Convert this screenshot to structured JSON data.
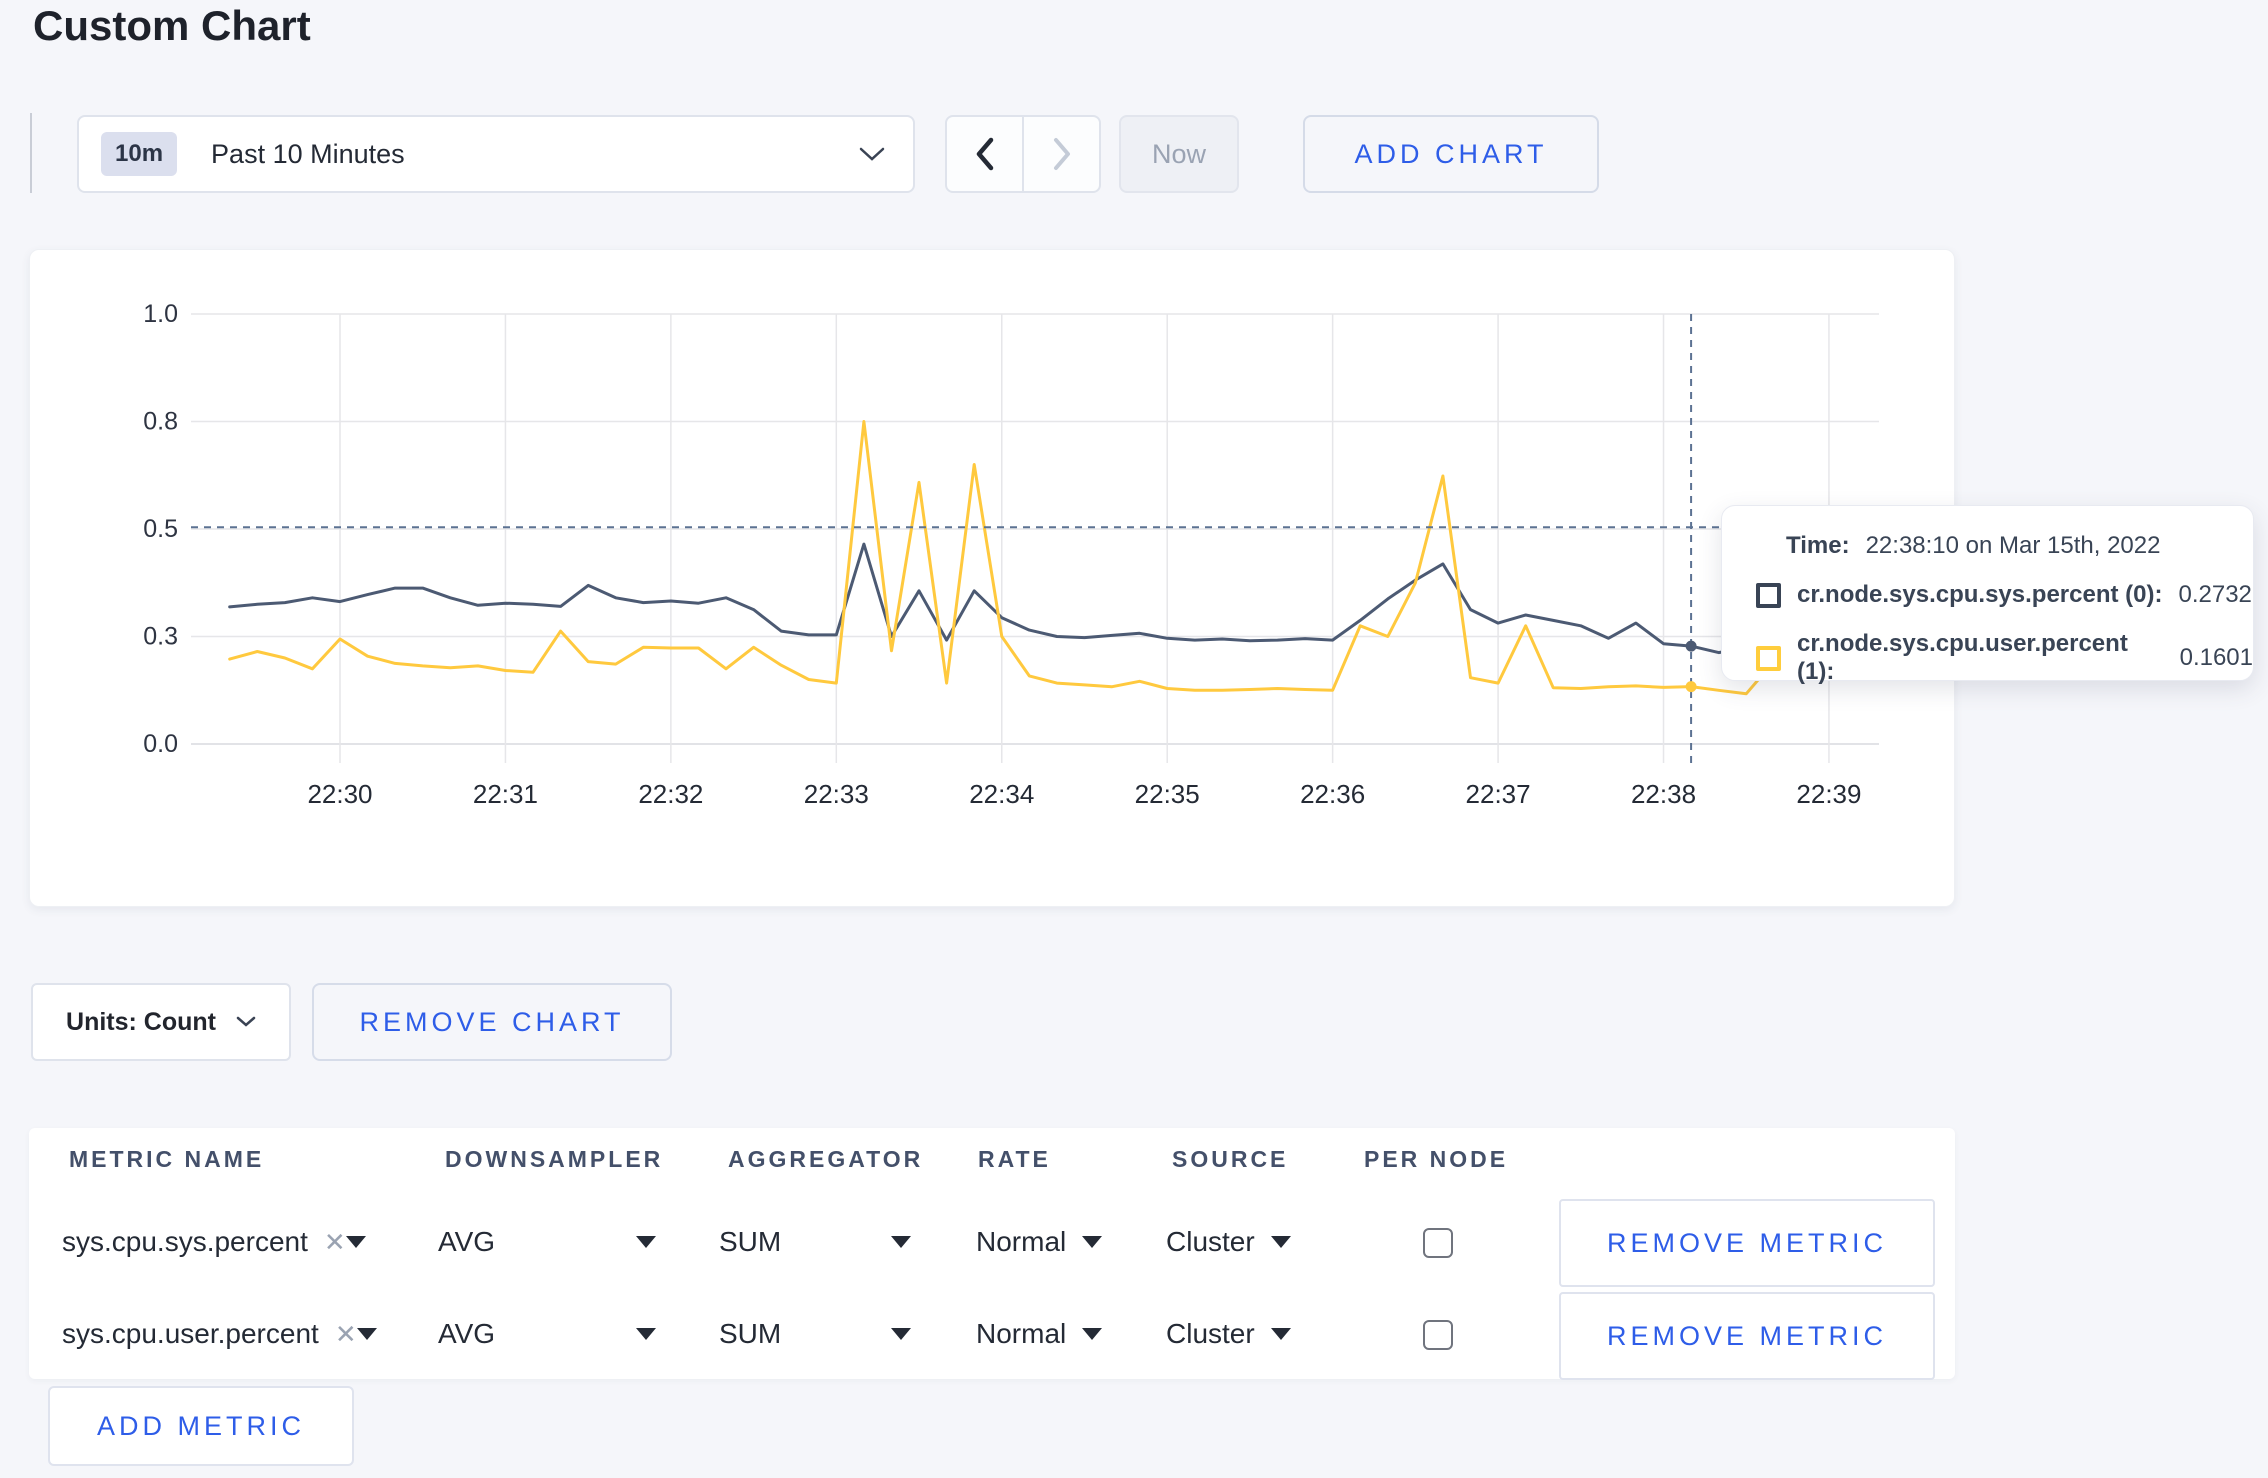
{
  "page": {
    "title": "Custom Chart"
  },
  "toolbar": {
    "time_window_badge": "10m",
    "time_window_label": "Past 10 Minutes",
    "now_label": "Now",
    "add_chart_label": "ADD CHART"
  },
  "chart_data": {
    "type": "line",
    "title": "",
    "x_ticks": [
      "22:30",
      "22:31",
      "22:32",
      "22:33",
      "22:34",
      "22:35",
      "22:36",
      "22:37",
      "22:38",
      "22:39"
    ],
    "y_ticks": {
      "labels": [
        "0.0",
        "0.3",
        "0.5",
        "0.8",
        "1.0"
      ],
      "values": [
        0,
        0.3,
        0.5,
        0.8,
        1.0
      ]
    },
    "ylim": [
      0,
      1
    ],
    "grid": true,
    "x_start_time": "22:29:20",
    "x_interval_seconds": 10,
    "series": [
      {
        "name": "cr.node.sys.cpu.sys.percent",
        "color": "#4c5a73",
        "values": [
          0.355,
          0.36,
          0.363,
          0.372,
          0.365,
          0.378,
          0.39,
          0.39,
          0.372,
          0.358,
          0.362,
          0.36,
          0.356,
          0.395,
          0.372,
          0.363,
          0.366,
          0.362,
          0.372,
          0.35,
          0.31,
          0.303,
          0.303,
          0.472,
          0.3,
          0.385,
          0.29,
          0.385,
          0.335,
          0.312,
          0.3,
          0.297,
          0.302,
          0.306,
          0.295,
          0.29,
          0.293,
          0.288,
          0.29,
          0.294,
          0.29,
          0.33,
          0.37,
          0.405,
          0.435,
          0.35,
          0.325,
          0.34,
          0.33,
          0.32,
          0.295,
          0.325,
          0.28,
          0.2732,
          0.255,
          0.27,
          0.285,
          0.27,
          0.285
        ]
      },
      {
        "name": "cr.node.sys.cpu.user.percent",
        "color": "#ffc93e",
        "values": [
          0.237,
          0.258,
          0.24,
          0.21,
          0.293,
          0.245,
          0.225,
          0.218,
          0.213,
          0.218,
          0.205,
          0.2,
          0.31,
          0.23,
          0.223,
          0.27,
          0.268,
          0.268,
          0.21,
          0.27,
          0.22,
          0.18,
          0.17,
          0.8,
          0.26,
          0.63,
          0.17,
          0.68,
          0.3,
          0.19,
          0.17,
          0.165,
          0.16,
          0.175,
          0.155,
          0.15,
          0.15,
          0.152,
          0.155,
          0.152,
          0.15,
          0.32,
          0.3,
          0.4,
          0.648,
          0.185,
          0.17,
          0.32,
          0.157,
          0.155,
          0.16,
          0.162,
          0.158,
          0.1601,
          0.15,
          0.14,
          0.23,
          0.25,
          0.22
        ]
      }
    ],
    "crosshair": {
      "time": "22:38:10",
      "sample_index": 53,
      "h_line_value": 0.505,
      "point_values": [
        0.2732,
        0.1601
      ]
    },
    "legend_position": "tooltip-only"
  },
  "tooltip": {
    "time_label": "Time:",
    "time_value": "22:38:10 on Mar 15th, 2022",
    "rows": [
      {
        "name": "cr.node.sys.cpu.sys.percent (0):",
        "value": "0.2732",
        "color": "#394455"
      },
      {
        "name": "cr.node.sys.cpu.user.percent (1):",
        "value": "0.1601",
        "color": "#ffcd3c"
      }
    ]
  },
  "chart_controls": {
    "units_label": "Units: Count",
    "remove_chart_label": "REMOVE CHART"
  },
  "metrics_table": {
    "headers": [
      "METRIC NAME",
      "DOWNSAMPLER",
      "AGGREGATOR",
      "RATE",
      "SOURCE",
      "PER NODE"
    ],
    "rows": [
      {
        "metric": "sys.cpu.sys.percent",
        "downsampler": "AVG",
        "aggregator": "SUM",
        "rate": "Normal",
        "source": "Cluster",
        "per_node_checked": false,
        "remove_label": "REMOVE METRIC"
      },
      {
        "metric": "sys.cpu.user.percent",
        "downsampler": "AVG",
        "aggregator": "SUM",
        "rate": "Normal",
        "source": "Cluster",
        "per_node_checked": false,
        "remove_label": "REMOVE METRIC"
      }
    ],
    "add_metric_label": "ADD METRIC"
  }
}
